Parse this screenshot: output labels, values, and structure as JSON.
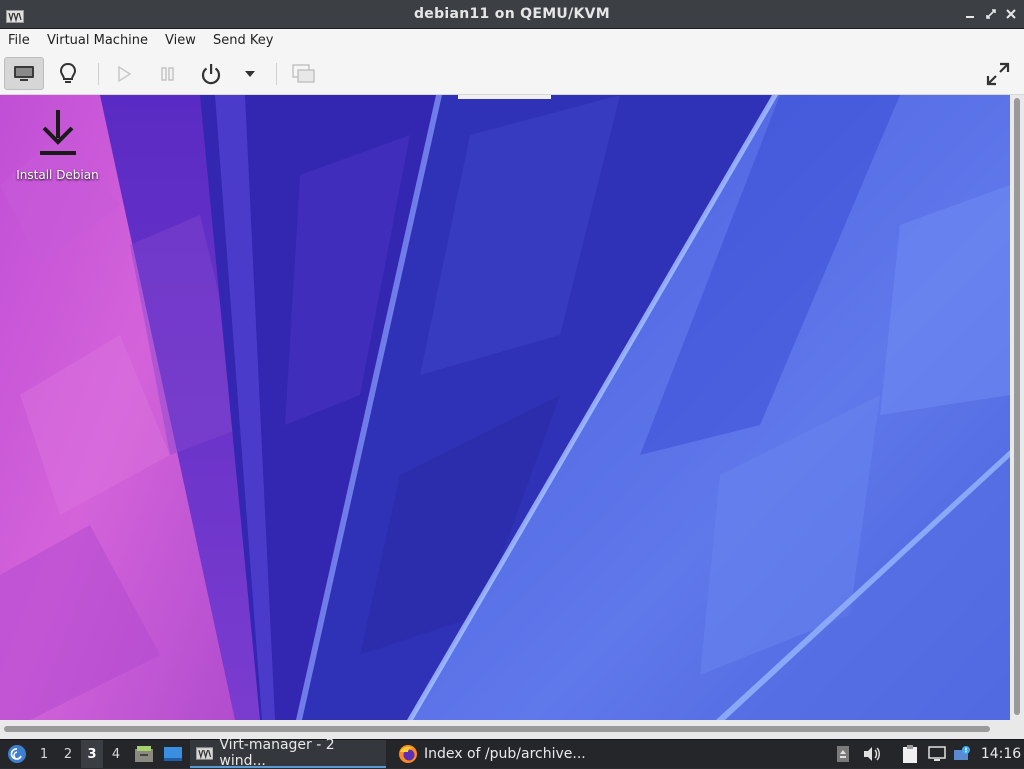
{
  "window": {
    "title": "debian11 on QEMU/KVM",
    "app_icon": "virt-manager-icon"
  },
  "menubar": {
    "items": [
      "File",
      "Virtual Machine",
      "View",
      "Send Key"
    ]
  },
  "toolbar": {
    "buttons": [
      {
        "name": "show-graphical-console",
        "icon": "monitor-icon",
        "active": true
      },
      {
        "name": "show-hardware-details",
        "icon": "lightbulb-icon"
      },
      {
        "name": "run",
        "icon": "play-icon",
        "enabled": false
      },
      {
        "name": "pause",
        "icon": "pause-icon",
        "enabled": false
      },
      {
        "name": "shut-down",
        "icon": "power-icon"
      },
      {
        "name": "shut-down-menu",
        "icon": "caret-down-icon"
      },
      {
        "name": "snapshots",
        "icon": "snapshots-icon",
        "enabled": false
      },
      {
        "name": "fullscreen",
        "icon": "fullscreen-icon"
      }
    ]
  },
  "guest": {
    "desktop_icons": [
      {
        "label": "Install Debian",
        "icon": "download-icon"
      }
    ]
  },
  "taskbar": {
    "workspaces": [
      "1",
      "2",
      "3",
      "4"
    ],
    "active_workspace": "3",
    "tasks": [
      {
        "label": "Virt-manager - 2 wind...",
        "icon": "virt-manager-icon",
        "active": true
      },
      {
        "label": "Index of /pub/archive...",
        "icon": "firefox-icon",
        "active": false
      }
    ],
    "clock": "14:16"
  },
  "colors": {
    "titlebar": "#3c3f44",
    "taskbar": "#24262a",
    "accent": "#5b9bd5"
  }
}
